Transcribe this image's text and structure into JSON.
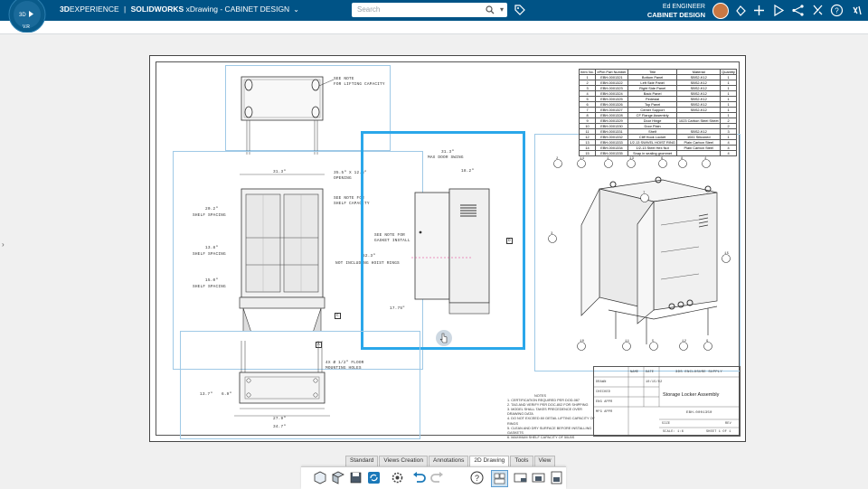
{
  "app": {
    "brand_prefix": "3D",
    "brand_experience": "EXPERIENCE",
    "brand_separator": "|",
    "brand_product": "SOLIDWORKS",
    "brand_app": "xDrawing - CABINET DESIGN",
    "compass_label": "V.R"
  },
  "search": {
    "placeholder": "Search"
  },
  "user": {
    "name": "Ed ENGINEER",
    "workspace": "CABINET DESIGN"
  },
  "top_icons": [
    "tag-icon",
    "share-icon",
    "add-icon",
    "play-icon",
    "network-icon",
    "tools-icon",
    "help-icon",
    "apps-icon"
  ],
  "drawing": {
    "views": {
      "top_note1": "SEE NOTE",
      "top_note2": "FOR LIFTING CAPACITY",
      "front_width": "31.3\"",
      "opening1": "35.5\" X 12.5\"",
      "opening2": "OPENING",
      "shelf_note1": "SEE NOTE FOR",
      "shelf_note2": "SHELF CAPACITY",
      "shelf1_val": "20.2\"",
      "shelf1_lbl": "SHELF SPACING",
      "shelf2_val": "13.8\"",
      "shelf2_lbl": "SHELF SPACING",
      "shelf3_val": "15.0\"",
      "shelf3_lbl": "SHELF SPACING",
      "hoist_val": "52.3\"",
      "hoist_lbl": "NOT INCLUDING HOIST RINGS",
      "door_swing_val": "31.3\"",
      "door_swing_lbl": "MAX DOOR SWING",
      "side_depth": "18.2\"",
      "gasket1": "SEE NOTE FOR",
      "gasket2": "GASKET INSTALL",
      "side_bottom": "17.75\"",
      "marker_c": "C",
      "marker_a": "A",
      "marker_d": "D",
      "floor1": "4X Ø 1/2\" FLOOR",
      "floor2": "MOUNTING HOLES",
      "bottom_left1": "13.7\"",
      "bottom_left2": "6.9\"",
      "bottom_w1": "27.9\"",
      "bottom_w2": "34.7\""
    },
    "bom": {
      "headers": [
        "Item No.",
        "ePlm Part Number",
        "Title",
        "Material",
        "Quantity"
      ],
      "rows": [
        [
          "1",
          "EBH-0001321",
          "Bottom Panel",
          "SBS2-K12",
          "1"
        ],
        [
          "2",
          "EBH-0001322",
          "Left Side Panel",
          "SBS2-K12",
          "1"
        ],
        [
          "3",
          "EBH-0001323",
          "Right Side Panel",
          "SBS2-K12",
          "1"
        ],
        [
          "4",
          "EBH-0001324",
          "Back Panel",
          "SBS2-K12",
          "1"
        ],
        [
          "5",
          "EBH-0001325",
          "Pedestal",
          "SBS2-K12",
          "1"
        ],
        [
          "6",
          "EBH-0001326",
          "Top Panel",
          "SBS2-K12",
          "1"
        ],
        [
          "7",
          "EBH-0001327",
          "Center Support",
          "SBS2-K12",
          "1"
        ],
        [
          "8",
          "EBH-0001328",
          "CF Flange Assembly",
          "",
          "1"
        ],
        [
          "9",
          "EBH-0001329",
          "Door Hinge",
          "1023 Carbon Steel Sheet",
          "2"
        ],
        [
          "10",
          "EBH-0001330",
          "Door Plain",
          "",
          "2"
        ],
        [
          "11",
          "EBH-0001331",
          "Shelf",
          "SBS2-K12",
          "3"
        ],
        [
          "12",
          "EBH-0001332",
          "Cliff Hook Locket",
          "1041 Siliconed",
          "1"
        ],
        [
          "13",
          "EBH-0001333",
          "1/2-13 SWIVEL HOIST RING",
          "Plain Carbon Steel",
          "4"
        ],
        [
          "14",
          "EBH-0001334",
          "1/2-13 Steel Hex Nut",
          "Plain Carbon Steel",
          "4"
        ],
        [
          "15",
          "EBH-0001335",
          "Snap in sealing grommet",
          "",
          "4"
        ]
      ]
    },
    "balloons": [
      "2",
      "14",
      "1",
      "13",
      "6",
      "8",
      "4",
      "3",
      "15",
      "10",
      "11",
      "5",
      "12",
      "7",
      "9"
    ],
    "notes": {
      "heading": "NOTES",
      "lines": [
        "1. CERTIFICATION REQUIRED PER DOD-087",
        "2. TAG AND VERIFY PER DOC-802 FOR SHIPPING",
        "3. MODEL SHALL TAKES PRECEDENCE OVER DRAWING DATA",
        "4. DO NOT EXCEED 8X DETAIL LIFTING CAPACITY OF RINGS",
        "5. CLEAN AND DRY SURFACE BEFORE INSTALLING GASKETS",
        "6. MAXIMUM SHELF CAPACITY OF 50LBS"
      ]
    },
    "title_block": {
      "company": "3DS ENCLOSURE SUPPLY",
      "title": "Storage Locker Assembly",
      "drawing_number": "EBH-0001350",
      "scale": "SCALE: 1:6",
      "size": "SIZE",
      "rev": "REV",
      "sheet": "SHEET 1 OF 1",
      "drawn": "DRAWN",
      "checked": "CHECKED",
      "eng_appr": "ENG APPR",
      "mfg_appr": "MFG APPR",
      "name": "NAME",
      "date": "DATE",
      "date_val": "10/15/02"
    }
  },
  "toolbar": {
    "tabs": [
      "Standard",
      "Views Creation",
      "Annotations",
      "2D Drawing",
      "Tools",
      "View"
    ],
    "active_tab": "2D Drawing",
    "tools": [
      "model-icon",
      "open-icon",
      "save-icon",
      "refresh-icon",
      "settings-icon",
      "undo-icon",
      "redo-icon",
      "help-icon",
      "views-icon",
      "sheet-icon",
      "sheet-alt-icon",
      "page-icon"
    ]
  },
  "colors": {
    "header": "#005386",
    "selection": "#2aa7ea",
    "view_frame": "#9fc9e6"
  }
}
